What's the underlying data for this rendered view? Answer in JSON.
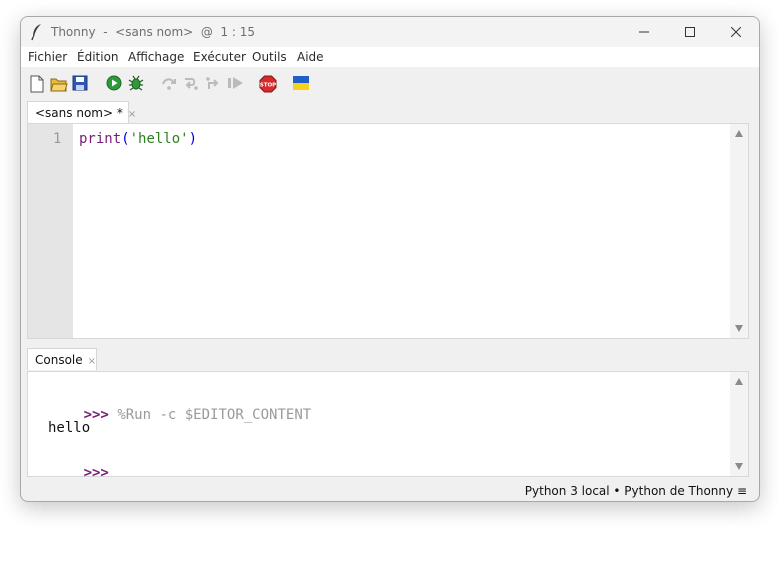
{
  "window": {
    "title": "Thonny  -  <sans nom>  @  1 : 15"
  },
  "menubar": {
    "items": [
      "Fichier",
      "Édition",
      "Affichage",
      "Exécuter",
      "Outils",
      "Aide"
    ]
  },
  "toolbar": {
    "icons": [
      "new-file-icon",
      "open-file-icon",
      "save-icon",
      "run-icon",
      "debug-icon",
      "step-over-icon",
      "step-into-icon",
      "step-out-icon",
      "resume-icon",
      "stop-icon",
      "ukraine-flag-icon"
    ],
    "stop_label": "STOP"
  },
  "editor": {
    "tab_label": "<sans nom> *",
    "tab_close": "×",
    "line_number": "1",
    "code": {
      "fn": "print",
      "open": "(",
      "str": "'hello'",
      "close": ")"
    }
  },
  "console": {
    "tab_label": "Console",
    "tab_close": "×",
    "prompt1": ">>>",
    "command": "%Run -c $EDITOR_CONTENT",
    "output": "hello",
    "prompt2": ">>>"
  },
  "statusbar": {
    "text": "Python 3 local  •  Python de Thonny  ≡"
  },
  "colors": {
    "prompt": "#7a1d7a",
    "keyword_fn": "#7a1d7a",
    "string": "#2e7d1e",
    "paren": "#0000dd"
  }
}
